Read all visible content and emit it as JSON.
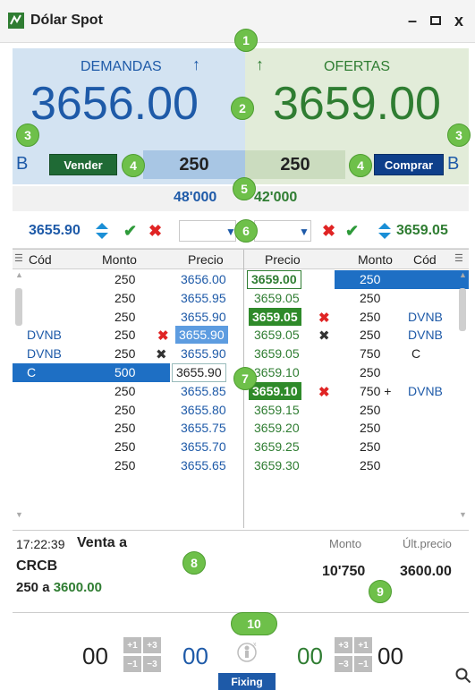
{
  "window": {
    "title": "Dólar Spot"
  },
  "quote": {
    "bid_header": "DEMANDAS",
    "ask_header": "OFERTAS",
    "bid_price": "3656.00",
    "ask_price": "3659.00",
    "bid_broker_flag": "B",
    "ask_broker_flag": "B",
    "sell_label": "Vender",
    "buy_label": "Comprar",
    "bid_qty": "250",
    "ask_qty": "250",
    "bid_total": "48'000",
    "ask_total": "42'000"
  },
  "order_entry": {
    "bid_best": "3655.90",
    "ask_best": "3659.05"
  },
  "book": {
    "columns_left": [
      "Cód",
      "Monto",
      "Precio"
    ],
    "columns_right": [
      "Precio",
      "Monto",
      "Cód"
    ],
    "bids": [
      {
        "code": "",
        "amount": "250",
        "price": "3656.00"
      },
      {
        "code": "",
        "amount": "250",
        "price": "3655.95"
      },
      {
        "code": "",
        "amount": "250",
        "price": "3655.90"
      },
      {
        "code": "DVNB",
        "amount": "250",
        "price": "3655.90"
      },
      {
        "code": "DVNB",
        "amount": "250",
        "price": "3655.90"
      },
      {
        "code": "C",
        "amount": "500",
        "price": "3655.90"
      },
      {
        "code": "",
        "amount": "250",
        "price": "3655.85"
      },
      {
        "code": "",
        "amount": "250",
        "price": "3655.80"
      },
      {
        "code": "",
        "amount": "250",
        "price": "3655.75"
      },
      {
        "code": "",
        "amount": "250",
        "price": "3655.70"
      },
      {
        "code": "",
        "amount": "250",
        "price": "3655.65"
      }
    ],
    "asks": [
      {
        "price": "3659.00",
        "amount": "250",
        "code": ""
      },
      {
        "price": "3659.05",
        "amount": "250",
        "code": ""
      },
      {
        "price": "3659.05",
        "amount": "250",
        "code": "DVNB"
      },
      {
        "price": "3659.05",
        "amount": "250",
        "code": "DVNB"
      },
      {
        "price": "3659.05",
        "amount": "750",
        "code": "C"
      },
      {
        "price": "3659.10",
        "amount": "250",
        "code": ""
      },
      {
        "price": "3659.10",
        "amount": "750 +",
        "code": "DVNB"
      },
      {
        "price": "3659.15",
        "amount": "250",
        "code": ""
      },
      {
        "price": "3659.20",
        "amount": "250",
        "code": ""
      },
      {
        "price": "3659.25",
        "amount": "250",
        "code": ""
      },
      {
        "price": "3659.30",
        "amount": "250",
        "code": ""
      }
    ]
  },
  "last_trade": {
    "time": "17:22:39",
    "side": "Venta a",
    "party": "CRCB",
    "detail_qty": "250 a",
    "detail_price": "3600.00",
    "label_monto": "Monto",
    "label_ult": "Últ.precio",
    "monto": "10'750",
    "ult_precio": "3600.00"
  },
  "fixing": {
    "left_a": "00",
    "left_b": "00",
    "right_a": "00",
    "right_b": "00",
    "plus1": "+1",
    "plus3": "+3",
    "minus1": "−1",
    "minus3": "−3",
    "button": "Fixing"
  },
  "callouts": [
    "1",
    "2",
    "3",
    "3",
    "4",
    "4",
    "5",
    "6",
    "7",
    "8",
    "9",
    "10"
  ],
  "colors": {
    "bid": "#1e5aa8",
    "ask": "#2f7d32",
    "sell": "#1f6a35",
    "buy": "#0e3f8a",
    "callout": "#6ec04a"
  }
}
